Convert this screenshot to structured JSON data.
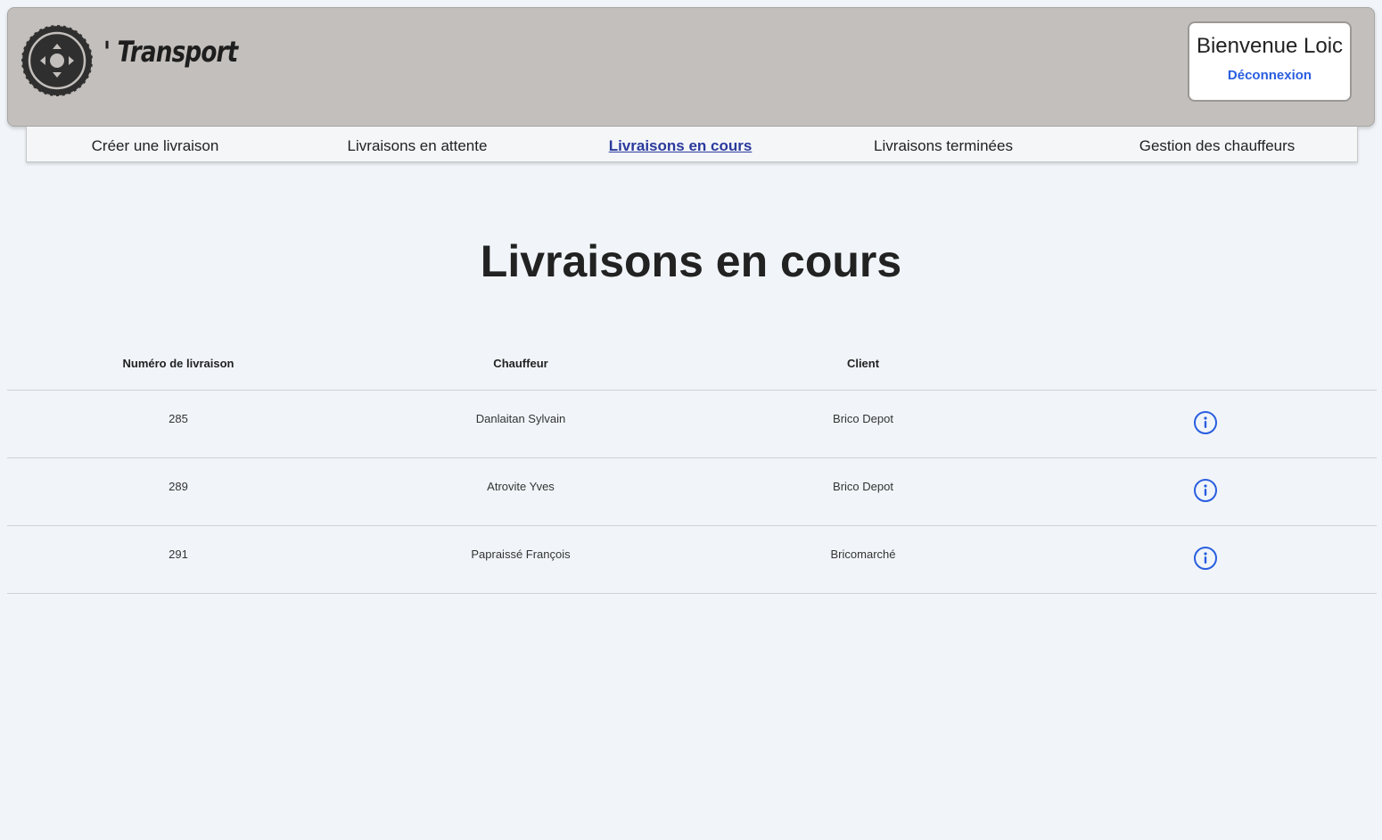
{
  "header": {
    "brand": "' Transport",
    "welcome": "Bienvenue Loic",
    "logout": "Déconnexion",
    "logo_icon": "tire-wheel-icon"
  },
  "nav": {
    "items": [
      {
        "label": "Créer une livraison",
        "active": false
      },
      {
        "label": "Livraisons en attente",
        "active": false
      },
      {
        "label": "Livraisons en cours",
        "active": true
      },
      {
        "label": "Livraisons terminées",
        "active": false
      },
      {
        "label": "Gestion des chauffeurs",
        "active": false
      }
    ]
  },
  "page": {
    "title": "Livraisons en cours"
  },
  "table": {
    "columns": [
      "Numéro de livraison",
      "Chauffeur",
      "Client",
      ""
    ],
    "rows": [
      {
        "numero": "285",
        "chauffeur": "Danlaitan Sylvain",
        "client": "Brico Depot"
      },
      {
        "numero": "289",
        "chauffeur": "Atrovite Yves",
        "client": "Brico Depot"
      },
      {
        "numero": "291",
        "chauffeur": "Papraissé François",
        "client": "Bricomarché"
      }
    ],
    "action_icon": "info-icon"
  },
  "colors": {
    "header_bg": "#c3bfbc",
    "page_bg": "#f1f5f9",
    "accent_blue": "#2a5ee0",
    "active_nav": "#2b3a9c"
  }
}
